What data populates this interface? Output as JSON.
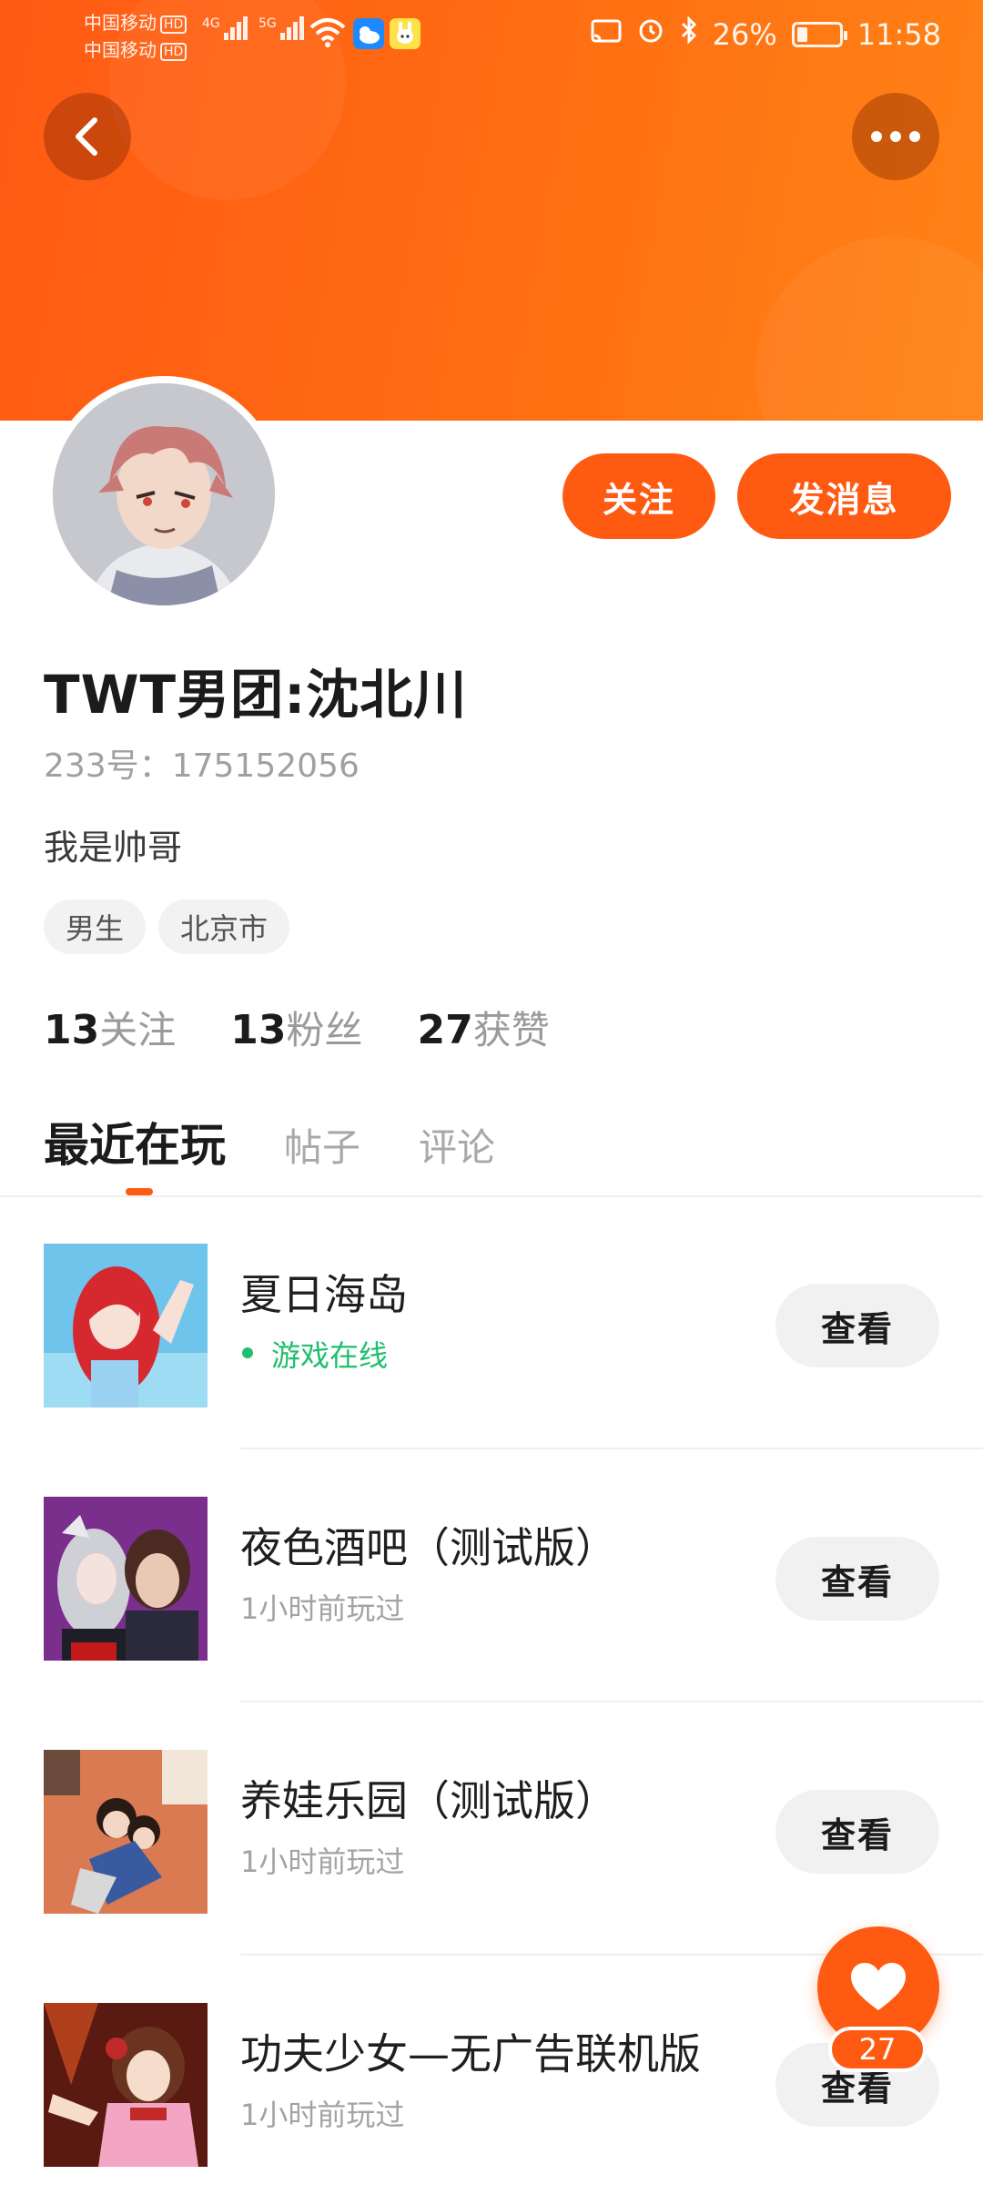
{
  "status_bar": {
    "carrier_1": "中国移动",
    "carrier_2": "中国移动",
    "hd": "HD",
    "net_1": "4G",
    "net_2": "5G",
    "battery": "26%",
    "battery_level": 0.26,
    "time": "11:58"
  },
  "profile": {
    "follow_label": "关注",
    "message_label": "发消息",
    "name": "TWT男团:沈北川",
    "id_line": "233号：175152056",
    "bio": "我是帅哥",
    "tags": [
      "男生",
      "北京市"
    ],
    "stats": [
      {
        "num": "13",
        "label": "关注"
      },
      {
        "num": "13",
        "label": "粉丝"
      },
      {
        "num": "27",
        "label": "获赞"
      }
    ]
  },
  "tabs": [
    "最近在玩",
    "帖子",
    "评论"
  ],
  "games": [
    {
      "title": "夏日海岛",
      "status": "游戏在线",
      "online": true,
      "button": "查看"
    },
    {
      "title": "夜色酒吧（测试版）",
      "status": "1小时前玩过",
      "online": false,
      "button": "查看"
    },
    {
      "title": "养娃乐园（测试版）",
      "status": "1小时前玩过",
      "online": false,
      "button": "查看"
    },
    {
      "title": "功夫少女—无广告联机版",
      "status": "1小时前玩过",
      "online": false,
      "button": "查看"
    }
  ],
  "like": {
    "count": "27"
  },
  "colors": {
    "accent": "#ff5a12",
    "online": "#1fbf6d"
  }
}
